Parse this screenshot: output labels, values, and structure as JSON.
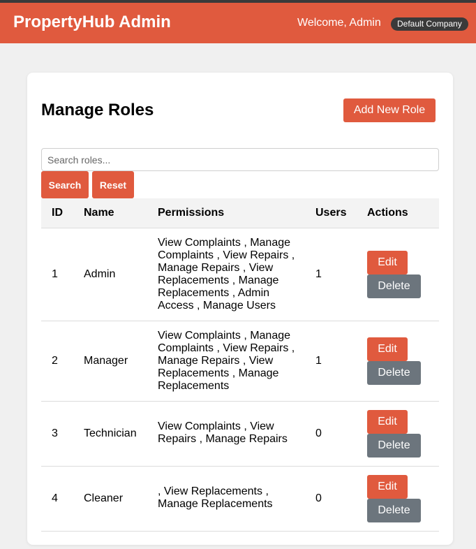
{
  "header": {
    "brand": "PropertyHub Admin",
    "welcome": "Welcome, Admin",
    "company_badge": "Default Company"
  },
  "main": {
    "title": "Manage Roles",
    "add_button": "Add New Role",
    "search": {
      "placeholder": "Search roles...",
      "value": ""
    },
    "search_button": "Search",
    "reset_button": "Reset",
    "columns": [
      "ID",
      "Name",
      "Permissions",
      "Users",
      "Actions"
    ],
    "rows": [
      {
        "id": "1",
        "name": "Admin",
        "permissions": "View Complaints , Manage Complaints , View Repairs , Manage Repairs , View Replacements , Manage Replacements , Admin Access , Manage Users",
        "users": "1",
        "edit": "Edit",
        "delete": "Delete"
      },
      {
        "id": "2",
        "name": "Manager",
        "permissions": "View Complaints , Manage Complaints , View Repairs , Manage Repairs , View Replacements , Manage Replacements",
        "users": "1",
        "edit": "Edit",
        "delete": "Delete"
      },
      {
        "id": "3",
        "name": "Technician",
        "permissions": "View Complaints , View Repairs , Manage Repairs",
        "users": "0",
        "edit": "Edit",
        "delete": "Delete"
      },
      {
        "id": "4",
        "name": "Cleaner",
        "permissions": ", View Replacements , Manage Replacements",
        "users": "0",
        "edit": "Edit",
        "delete": "Delete"
      }
    ]
  },
  "colors": {
    "accent": "#e05a3e",
    "secondary_button": "#6c757d",
    "badge": "#3a3a3a"
  }
}
